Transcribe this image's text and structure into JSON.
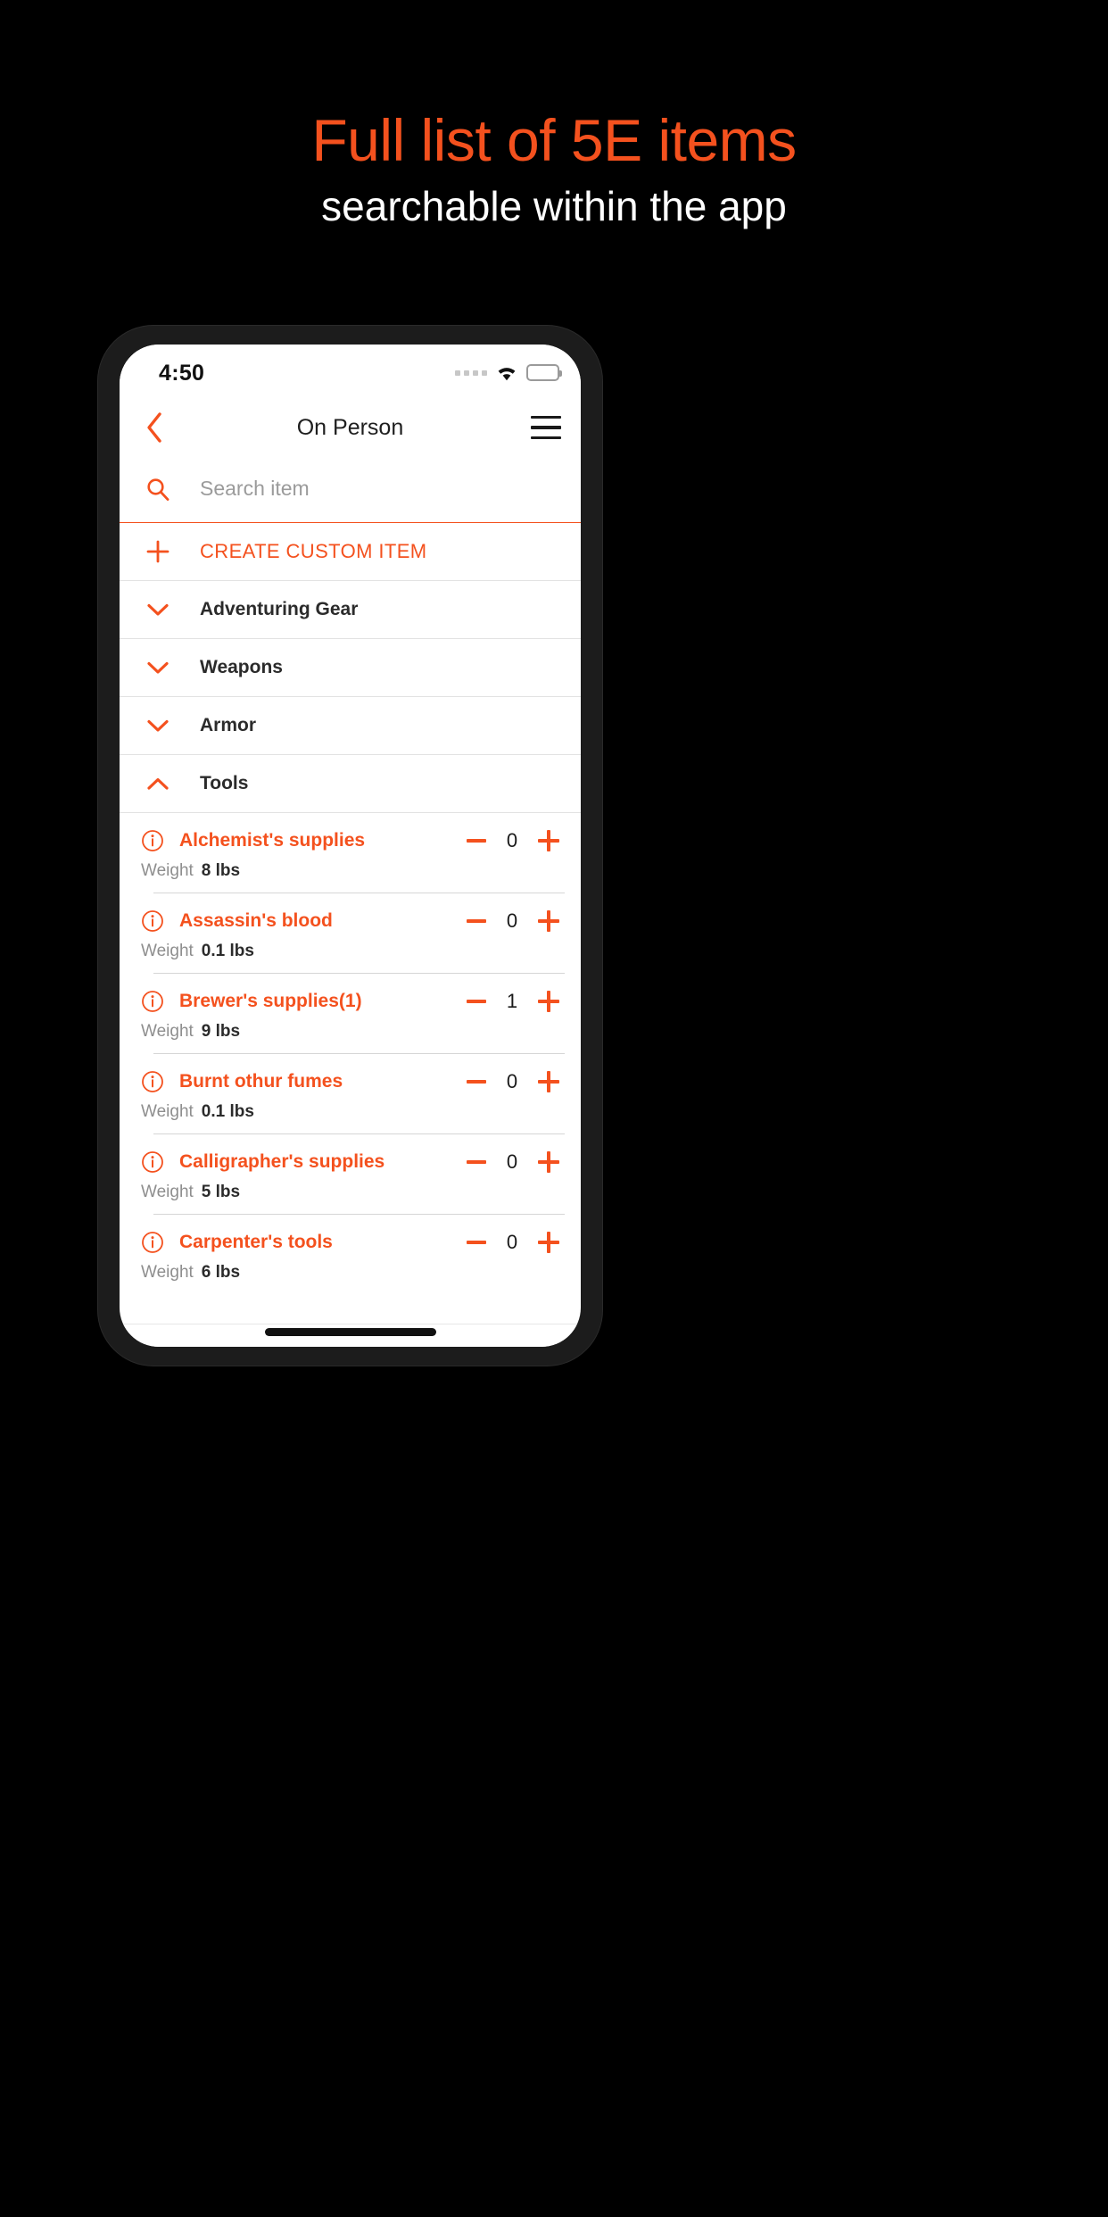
{
  "promo": {
    "title": "Full list of 5E items",
    "subtitle": "searchable within the app",
    "title_color": "#f4511e",
    "subtitle_color": "#ffffff",
    "background_color": "#000000"
  },
  "accent_color": "#f4511e",
  "status_bar": {
    "time": "4:50",
    "signal_icon": "signal-dots-icon",
    "wifi_icon": "wifi-icon",
    "battery_icon": "battery-low-icon",
    "battery_level_percent": 22
  },
  "nav": {
    "back_icon": "chevron-left-icon",
    "title": "On Person",
    "menu_icon": "hamburger-menu-icon"
  },
  "search": {
    "icon": "search-icon",
    "placeholder": "Search item",
    "value": ""
  },
  "create_custom": {
    "icon": "plus-icon",
    "label": "CREATE CUSTOM ITEM"
  },
  "categories": [
    {
      "label": "Adventuring Gear",
      "icon": "chevron-down-icon",
      "expanded": false
    },
    {
      "label": "Weapons",
      "icon": "chevron-down-icon",
      "expanded": false
    },
    {
      "label": "Armor",
      "icon": "chevron-down-icon",
      "expanded": false
    },
    {
      "label": "Tools",
      "icon": "chevron-up-icon",
      "expanded": true
    }
  ],
  "items": [
    {
      "info_icon": "info-circle-icon",
      "name": "Alchemist's supplies",
      "weight_label": "Weight",
      "weight_value": "8 lbs",
      "count": "0",
      "minus_icon": "minus-icon",
      "plus_icon": "plus-icon"
    },
    {
      "info_icon": "info-circle-icon",
      "name": "Assassin's blood",
      "weight_label": "Weight",
      "weight_value": "0.1 lbs",
      "count": "0",
      "minus_icon": "minus-icon",
      "plus_icon": "plus-icon"
    },
    {
      "info_icon": "info-circle-icon",
      "name": "Brewer's supplies(1)",
      "weight_label": "Weight",
      "weight_value": "9 lbs",
      "count": "1",
      "minus_icon": "minus-icon",
      "plus_icon": "plus-icon"
    },
    {
      "info_icon": "info-circle-icon",
      "name": "Burnt othur fumes",
      "weight_label": "Weight",
      "weight_value": "0.1 lbs",
      "count": "0",
      "minus_icon": "minus-icon",
      "plus_icon": "plus-icon"
    },
    {
      "info_icon": "info-circle-icon",
      "name": "Calligrapher's supplies",
      "weight_label": "Weight",
      "weight_value": "5 lbs",
      "count": "0",
      "minus_icon": "minus-icon",
      "plus_icon": "plus-icon"
    },
    {
      "info_icon": "info-circle-icon",
      "name": "Carpenter's tools",
      "weight_label": "Weight",
      "weight_value": "6 lbs",
      "count": "0",
      "minus_icon": "minus-icon",
      "plus_icon": "plus-icon"
    }
  ],
  "home_indicator": "home-indicator"
}
